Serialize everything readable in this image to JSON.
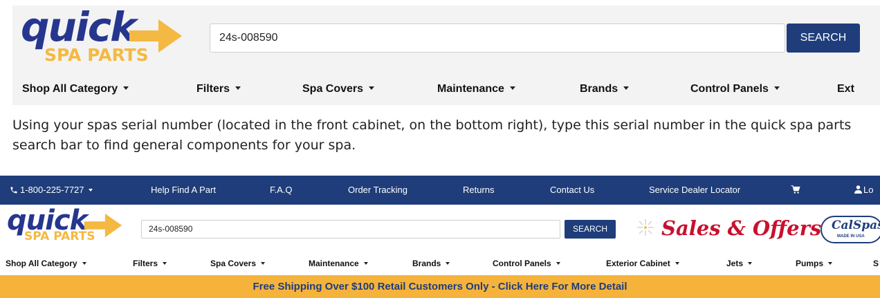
{
  "colors": {
    "brand_navy": "#1f3d7a",
    "logo_blue": "#26368f",
    "logo_orange": "#f4b942",
    "ship_bar": "#f5b33c",
    "offers_red": "#c8102e"
  },
  "screenshot1": {
    "logo": {
      "word": "quick",
      "sub": "SPA PARTS"
    },
    "search": {
      "value": "24s-008590",
      "button": "SEARCH"
    },
    "nav": [
      "Shop All Category",
      "Filters",
      "Spa Covers",
      "Maintenance",
      "Brands",
      "Control Panels",
      "Ext"
    ]
  },
  "instruction": "Using your spas serial number (located in the front cabinet, on the bottom right), type this serial number in the quick spa parts search bar to find general components for your spa.",
  "screenshot2": {
    "topbar": {
      "phone": "1-800-225-7727",
      "links": [
        "Help Find A Part",
        "F.A.Q",
        "Order Tracking",
        "Returns",
        "Contact Us",
        "Service Dealer Locator"
      ],
      "login": "Lo"
    },
    "logo": {
      "word": "quick",
      "sub": "SPA PARTS"
    },
    "search": {
      "value": "24s-008590",
      "button": "SEARCH"
    },
    "promo": "Sales & Offers",
    "brand_badge": {
      "name": "CalSpas",
      "tag": "MADE IN USA"
    },
    "nav": [
      "Shop All Category",
      "Filters",
      "Spa Covers",
      "Maintenance",
      "Brands",
      "Control Panels",
      "Exterior Cabinet",
      "Jets",
      "Pumps",
      "S"
    ],
    "shipping_banner": "Free Shipping Over $100 Retail Customers Only - Click Here For More Detail"
  }
}
